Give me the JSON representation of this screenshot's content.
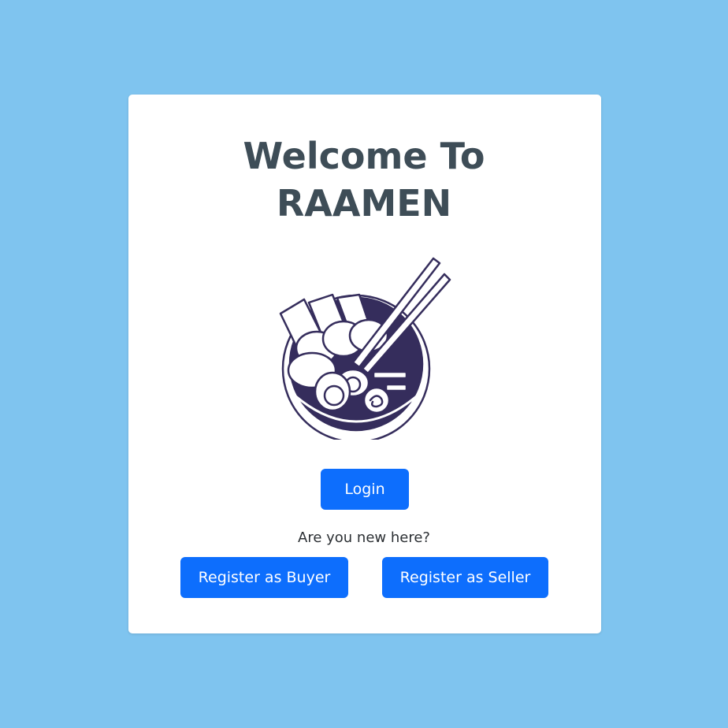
{
  "header": {
    "title_line1": "Welcome To",
    "title_line2": "RAAMEN"
  },
  "logo": {
    "icon": "ramen-bowl-icon"
  },
  "actions": {
    "login_label": "Login",
    "new_user_prompt": "Are you new here?",
    "register_buyer_label": "Register as Buyer",
    "register_seller_label": "Register as Seller"
  },
  "colors": {
    "background": "#7fc4ef",
    "card": "#ffffff",
    "title": "#3e4d57",
    "primary_button": "#0d6efd",
    "illustration": "#352d5c"
  }
}
